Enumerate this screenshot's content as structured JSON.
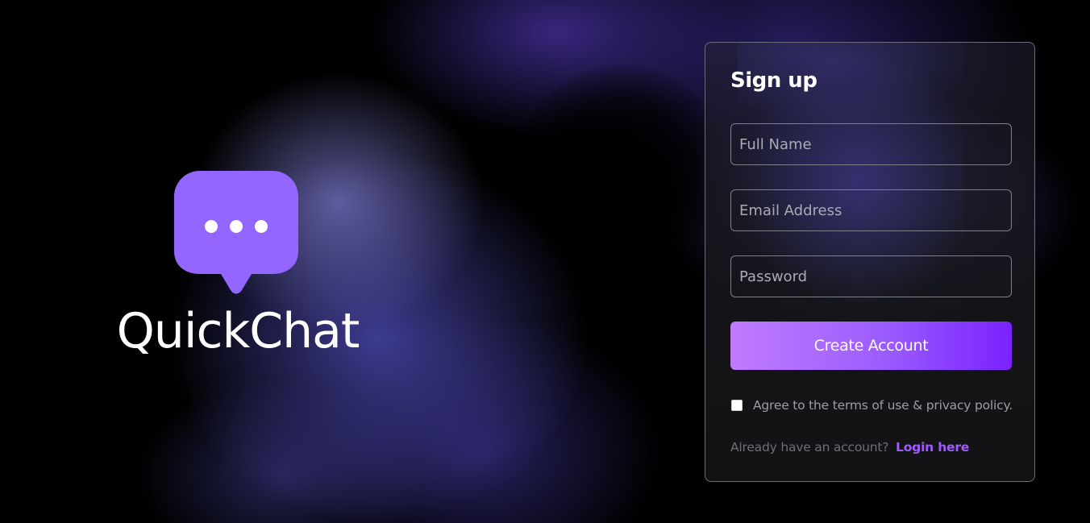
{
  "brand": {
    "name": "QuickChat",
    "logo_icon": "chat-bubble-dots-icon",
    "logo_color": "#9366ff"
  },
  "signup": {
    "title": "Sign up",
    "fields": {
      "full_name": {
        "placeholder": "Full Name",
        "value": ""
      },
      "email": {
        "placeholder": "Email Address",
        "value": ""
      },
      "password": {
        "placeholder": "Password",
        "value": ""
      }
    },
    "submit_label": "Create Account",
    "agree": {
      "checked": false,
      "label": "Agree to the terms of use & privacy policy."
    },
    "login_prompt": "Already have an account?",
    "login_link": "Login here"
  },
  "colors": {
    "accent": "#a25bff",
    "button_gradient_start": "#c07bff",
    "button_gradient_end": "#7a22ff",
    "background": "#000000"
  }
}
